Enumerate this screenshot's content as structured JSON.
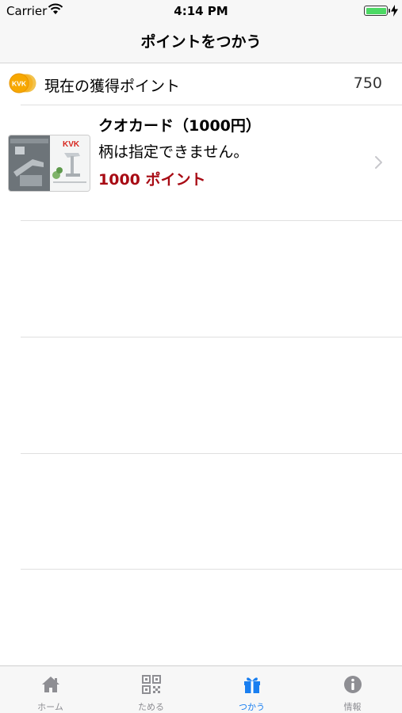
{
  "status_bar": {
    "carrier": "Carrier",
    "time": "4:14 PM"
  },
  "nav": {
    "title": "ポイントをつかう"
  },
  "points": {
    "label": "現在の獲得ポイント",
    "value": "750",
    "coin_text": "KVK"
  },
  "rewards": [
    {
      "title": "クオカード（1000円）",
      "description": "柄は指定できません。",
      "cost": "1000 ポイント",
      "thumb_brand": "KVK"
    }
  ],
  "tabs": [
    {
      "label": "ホーム",
      "icon": "home-icon",
      "active": false
    },
    {
      "label": "ためる",
      "icon": "qr-code-icon",
      "active": false
    },
    {
      "label": "つかう",
      "icon": "gift-icon",
      "active": true
    },
    {
      "label": "情報",
      "icon": "info-icon",
      "active": false
    }
  ],
  "colors": {
    "accent": "#1a7ff0",
    "points_red": "#a80b14",
    "coin_gold": "#f4b400",
    "battery_green": "#4cd964"
  }
}
